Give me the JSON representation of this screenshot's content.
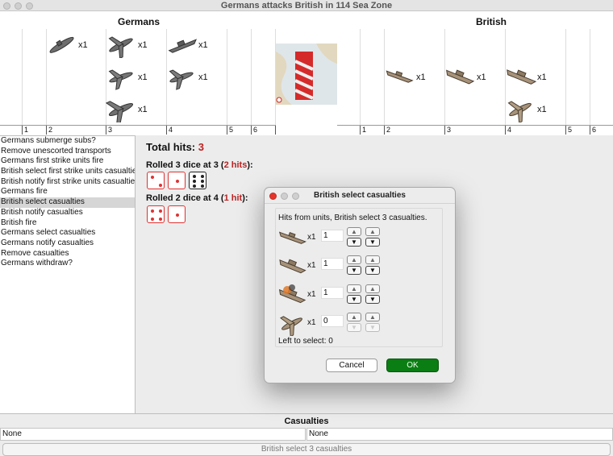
{
  "window": {
    "title": "Germans attacks British in 114 Sea Zone"
  },
  "attacker": {
    "name": "Germans",
    "ruler": [
      "1",
      "2",
      "3",
      "4",
      "5",
      "6"
    ],
    "units": [
      {
        "icon": "submarine-icon",
        "count": "x1"
      },
      {
        "icon": "fighter-plane-icon",
        "count": "x1"
      },
      {
        "icon": "tactical-bomber-icon",
        "count": "x1"
      },
      {
        "icon": "bomber-icon",
        "count": "x1"
      },
      {
        "icon": "battleship-icon",
        "count": "x1"
      },
      {
        "icon": "tactical-bomber-icon",
        "count": "x1"
      }
    ]
  },
  "defender": {
    "name": "British",
    "ruler": [
      "1",
      "2",
      "3",
      "4",
      "5",
      "6"
    ],
    "units": [
      {
        "icon": "destroyer-icon",
        "count": "x1"
      },
      {
        "icon": "cruiser-icon",
        "count": "x1"
      },
      {
        "icon": "battleship-icon",
        "count": "x1"
      },
      {
        "icon": "fighter-plane-icon",
        "count": "x1"
      }
    ]
  },
  "steps": [
    "Germans submerge subs?",
    "Remove unescorted transports",
    "Germans first strike units fire",
    "British select first strike units casualties",
    "British notify first strike units casualties",
    "Germans fire",
    "British select casualties",
    "British notify casualties",
    "British fire",
    "Germans select casualties",
    "Germans notify casualties",
    "Remove casualties",
    "Germans withdraw?"
  ],
  "selected_step": "British select casualties",
  "results": {
    "total_hits_label": "Total hits:",
    "total_hits": "3",
    "roll1": {
      "prefix": "Rolled 3 dice at 3 (",
      "hits": "2 hits",
      "suffix": "):",
      "dice": [
        2,
        1,
        6
      ]
    },
    "roll2": {
      "prefix": "Rolled 2 dice at 4 (",
      "hits": "1 hit",
      "suffix": "):",
      "dice": [
        4,
        1
      ]
    }
  },
  "casualties": {
    "title": "Casualties",
    "attacker_value": "None",
    "defender_value": "None",
    "status_button": "British select 3 casualties"
  },
  "dialog": {
    "title": "British select casualties",
    "hits_text": "Hits from units,  British select 3 casualties.",
    "rows": [
      {
        "icon": "destroyer-icon",
        "count": "x1",
        "value": "1"
      },
      {
        "icon": "cruiser-icon",
        "count": "x1",
        "value": "1"
      },
      {
        "icon": "damaged-battleship-icon",
        "count": "x1",
        "value": "1"
      },
      {
        "icon": "fighter-plane-icon",
        "count": "x1",
        "value": "0"
      }
    ],
    "up_symbol": "▲",
    "down_symbol": "▼",
    "left_to_select": "Left to select: 0",
    "cancel_label": "Cancel",
    "ok_label": "OK"
  },
  "colors": {
    "hit": "#dd3333",
    "ok_button": "#0a7d13",
    "german_unit": "#6e6e6e",
    "british_unit": "#a7927a"
  }
}
